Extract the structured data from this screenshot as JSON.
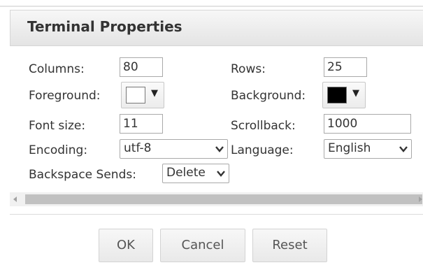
{
  "dialog": {
    "title": "Terminal Properties"
  },
  "fields": {
    "columns": {
      "label": "Columns:",
      "value": "80"
    },
    "rows": {
      "label": "Rows:",
      "value": "25"
    },
    "foreground": {
      "label": "Foreground:",
      "color": "#ffffff"
    },
    "background": {
      "label": "Background:",
      "color": "#000000"
    },
    "font_size": {
      "label": "Font size:",
      "value": "11"
    },
    "scrollback": {
      "label": "Scrollback:",
      "value": "1000"
    },
    "encoding": {
      "label": "Encoding:",
      "value": "utf-8"
    },
    "language": {
      "label": "Language:",
      "value": "English"
    },
    "backspace": {
      "label": "Backspace Sends:",
      "value": "Delete"
    }
  },
  "buttons": {
    "ok": "OK",
    "cancel": "Cancel",
    "reset": "Reset"
  },
  "icons": {
    "dropdown_arrow": "▼"
  }
}
